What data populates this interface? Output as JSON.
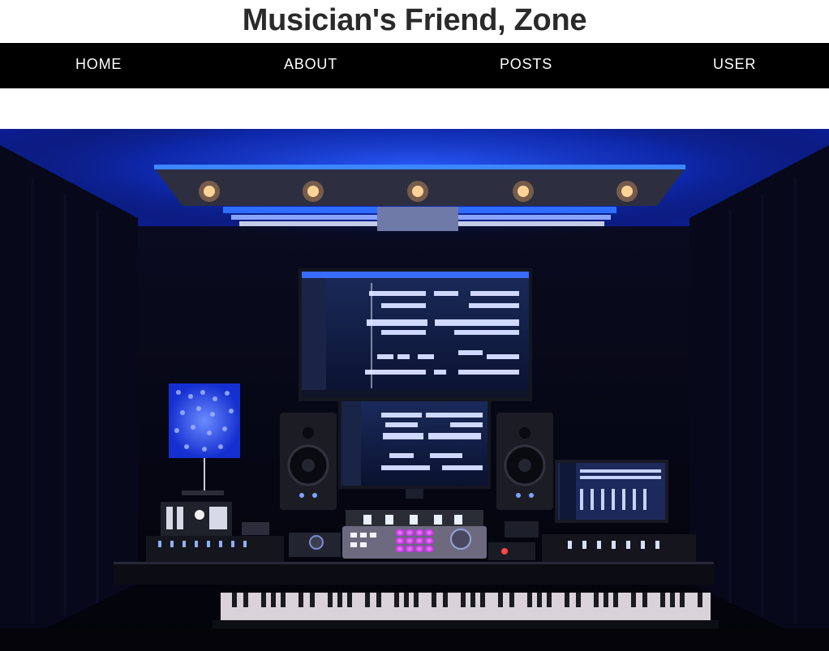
{
  "site": {
    "title": "Musician's Friend, Zone"
  },
  "nav": {
    "items": [
      {
        "label": "HOME"
      },
      {
        "label": "ABOUT"
      },
      {
        "label": "POSTS"
      },
      {
        "label": "USER"
      }
    ]
  },
  "hero": {
    "image_icon": "studio-photo",
    "accent_color": "#1f4dff"
  }
}
